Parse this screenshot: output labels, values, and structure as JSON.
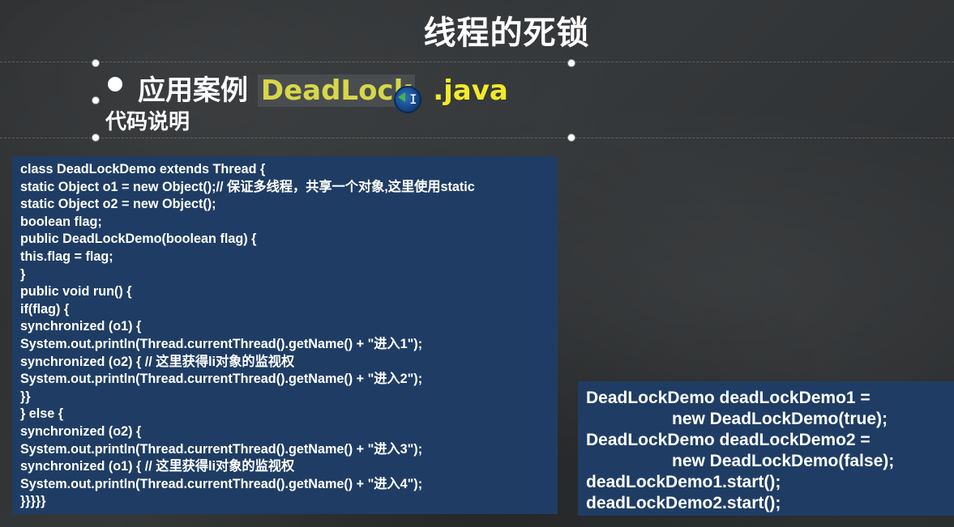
{
  "slide": {
    "title": "线程的死锁",
    "heading_prefix": "应用案例",
    "heading_highlight": "DeadLock",
    "heading_suffix": ".java",
    "subheading": "代码说明"
  },
  "code_block": {
    "lines": [
      "class DeadLockDemo extends Thread {",
      "static Object o1 = new Object();// 保证多线程，共享一个对象,这里使用static",
      "static Object o2 = new Object();",
      "boolean flag;",
      "public DeadLockDemo(boolean flag) {",
      "this.flag = flag;",
      "}",
      "public void run() {",
      "if(flag) {",
      "synchronized (o1) {",
      "System.out.println(Thread.currentThread().getName() + \"进入1\");",
      "synchronized (o2) { // 这里获得li对象的监视权",
      "System.out.println(Thread.currentThread().getName() + \"进入2\");",
      "}}",
      "} else {",
      "synchronized (o2) {",
      "System.out.println(Thread.currentThread().getName() + \"进入3\");",
      "synchronized (o1) { // 这里获得li对象的监视权",
      "System.out.println(Thread.currentThread().getName() + \"进入4\");",
      "}}}}}"
    ]
  },
  "usage_block": {
    "lines": [
      "DeadLockDemo deadLockDemo1 =",
      "new DeadLockDemo(true);",
      "DeadLockDemo deadLockDemo2 =",
      "new DeadLockDemo(false);",
      "deadLockDemo1.start();",
      "deadLockDemo2.start();"
    ]
  },
  "colors": {
    "panel_bg": "#1f3d64",
    "highlight_text": "#d7d74a",
    "java_text": "#f2ea2a"
  }
}
